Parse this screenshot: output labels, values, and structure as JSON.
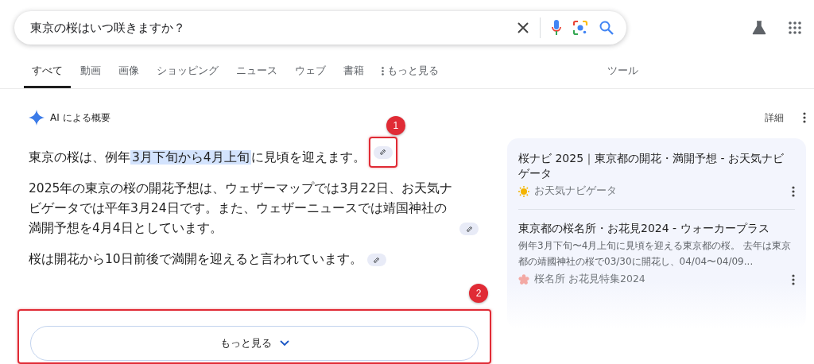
{
  "search": {
    "query": "東京の桜はいつ咲きますか？"
  },
  "tabs": [
    {
      "label": "すべて",
      "selected": true,
      "kind": "plain"
    },
    {
      "label": "動画",
      "selected": false,
      "kind": "plain"
    },
    {
      "label": "画像",
      "selected": false,
      "kind": "plain"
    },
    {
      "label": "ショッピング",
      "selected": false,
      "kind": "plain"
    },
    {
      "label": "ニュース",
      "selected": false,
      "kind": "plain"
    },
    {
      "label": "ウェブ",
      "selected": false,
      "kind": "plain"
    },
    {
      "label": "書籍",
      "selected": false,
      "kind": "plain"
    },
    {
      "label": "もっと見る",
      "selected": false,
      "kind": "more"
    }
  ],
  "tools_label": "ツール",
  "overview": {
    "heading": "AI による概要",
    "paragraphs": [
      {
        "before": "東京の桜は、例年",
        "highlight": "3月下旬から4月上旬",
        "after": "に見頃を迎えます。",
        "annotation": "1"
      },
      {
        "before": "2025年の東京の桜の開花予想は、ウェザーマップでは3月22日、お天気ナビゲータでは平年3月24日です。また、ウェザーニュースでは靖国神社の満開予想を4月4日としています。"
      },
      {
        "before": "桜は開花から10日前後で満開を迎えると言われています。"
      }
    ]
  },
  "more_button": {
    "label": "もっと見る",
    "annotation": "2"
  },
  "side": {
    "details_label": "詳細",
    "results": [
      {
        "title": "桜ナビ 2025｜東京都の開花・満開予想 - お天気ナビゲータ",
        "source": "お天気ナビゲータ",
        "kind": "sun"
      },
      {
        "title": "東京都の桜名所・お花見2024 - ウォーカープラス",
        "snippet": "例年3月下旬〜4月上旬に見頃を迎える東京都の桜。 去年は東京都の靖國神社の桜で03/30に開花し、04/04〜04/09...",
        "source": "桜名所 お花見特集2024",
        "kind": "blossom"
      }
    ]
  }
}
